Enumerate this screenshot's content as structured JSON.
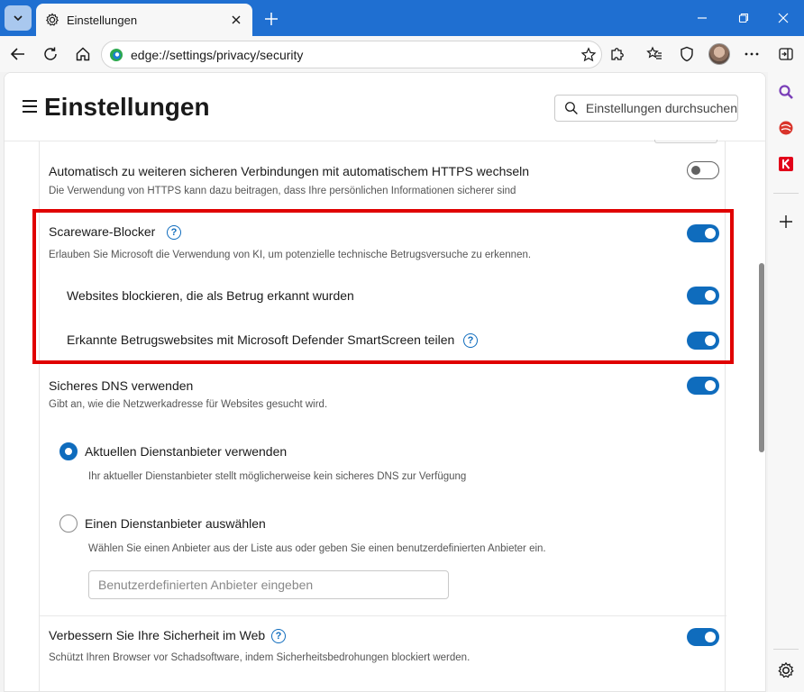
{
  "browser": {
    "tab_title": "Einstellungen",
    "url": "edge://settings/privacy/security"
  },
  "header": {
    "title": "Einstellungen",
    "search_placeholder": "Einstellungen durchsuchen"
  },
  "settings": {
    "https": {
      "title": "Automatisch zu weiteren sicheren Verbindungen mit automatischem HTTPS wechseln",
      "desc": "Die Verwendung von HTTPS kann dazu beitragen, dass Ihre persönlichen Informationen sicherer sind",
      "enabled": false
    },
    "scareware": {
      "title": "Scareware-Blocker",
      "desc": "Erlauben Sie Microsoft die Verwendung von KI, um potenzielle technische Betrugsversuche zu erkennen.",
      "enabled": true
    },
    "block_sites": {
      "title": "Websites blockieren, die als Betrug erkannt wurden",
      "enabled": true
    },
    "share_smartscreen": {
      "title": "Erkannte Betrugswebsites mit Microsoft Defender SmartScreen teilen",
      "enabled": true
    },
    "secure_dns": {
      "title": "Sicheres DNS verwenden",
      "desc": "Gibt an, wie die Netzwerkadresse für Websites gesucht wird.",
      "enabled": true
    },
    "dns_current": {
      "title": "Aktuellen Dienstanbieter verwenden",
      "desc": "Ihr aktueller Dienstanbieter stellt möglicherweise kein sicheres DNS zur Verfügung",
      "selected": true
    },
    "dns_choose": {
      "title": "Einen Dienstanbieter auswählen",
      "desc": "Wählen Sie einen Anbieter aus der Liste aus oder geben Sie einen benutzerdefinierten Anbieter ein.",
      "input_placeholder": "Benutzerdefinierten Anbieter eingeben",
      "selected": false
    },
    "improve_security": {
      "title": "Verbessern Sie Ihre Sicherheit im Web",
      "desc": "Schützt Ihren Browser vor Schadsoftware, indem Sicherheitsbedrohungen blockiert werden.",
      "enabled": true
    },
    "help_glyph": "?"
  },
  "colors": {
    "accent": "#0f6cbd",
    "highlight": "#e00000",
    "titlebar": "#1f6fd1"
  }
}
